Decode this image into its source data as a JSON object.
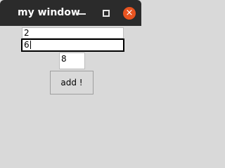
{
  "window": {
    "title": "my window",
    "close_glyph": "×"
  },
  "fields": {
    "first_value": "2",
    "second_value": "6",
    "result_value": "8"
  },
  "buttons": {
    "add_label": "add !"
  },
  "icons": {
    "minimize": "minimize-icon",
    "maximize": "maximize-icon",
    "close": "close-icon"
  },
  "colors": {
    "titlebar": "#2b2b2b",
    "close_button": "#e95420",
    "window_bg": "#d9d9d9"
  }
}
